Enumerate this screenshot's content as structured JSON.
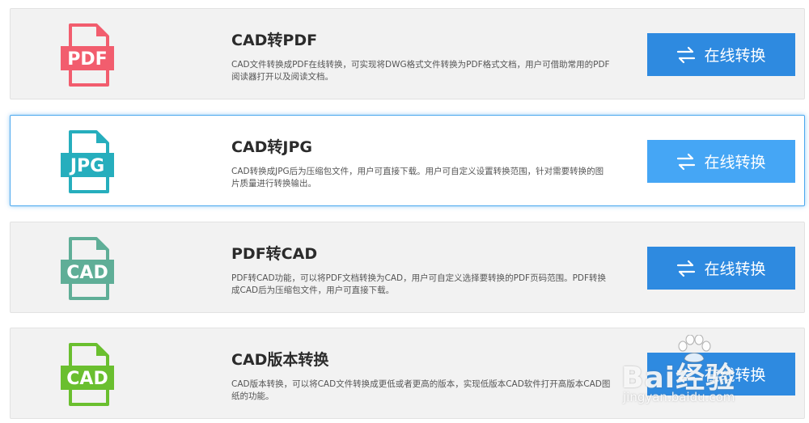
{
  "cards": [
    {
      "title": "CAD转PDF",
      "icon_label": "PDF",
      "icon_name": "pdf-file-icon",
      "icon_color": "#f25d6e",
      "description": "CAD文件转换成PDF在线转换，可实现将DWG格式文件转换为PDF格式文档，用户可借助常用的PDF阅读器打开以及阅读文档。",
      "button_label": "在线转换",
      "active": false
    },
    {
      "title": "CAD转JPG",
      "icon_label": "JPG",
      "icon_name": "jpg-file-icon",
      "icon_color": "#26aebd",
      "description": "CAD转换成JPG后为压缩包文件，用户可直接下载。用户可自定义设置转换范围，针对需要转换的图片质量进行转换输出。",
      "button_label": "在线转换",
      "active": true
    },
    {
      "title": "PDF转CAD",
      "icon_label": "CAD",
      "icon_name": "cad-file-icon",
      "icon_color": "#5fae97",
      "description": "PDF转CAD功能，可以将PDF文档转换为CAD，用户可自定义选择要转换的PDF页码范围。PDF转换成CAD后为压缩包文件，用户可直接下载。",
      "button_label": "在线转换",
      "active": false
    },
    {
      "title": "CAD版本转换",
      "icon_label": "CAD",
      "icon_name": "cad-version-file-icon",
      "icon_color": "#6abf2f",
      "description": "CAD版本转换，可以将CAD文件转换成更低或者更高的版本，实现低版本CAD软件打开高版本CAD图纸的功能。",
      "button_label": "在线转换",
      "active": false
    }
  ],
  "colors": {
    "button": "#2e8ae0",
    "button_active": "#45a6f5",
    "active_border": "#4aa8ee",
    "card_bg": "#f2f2f2"
  },
  "watermark": {
    "brand": "Bai经验",
    "url": "jingyan.baidu.com"
  }
}
